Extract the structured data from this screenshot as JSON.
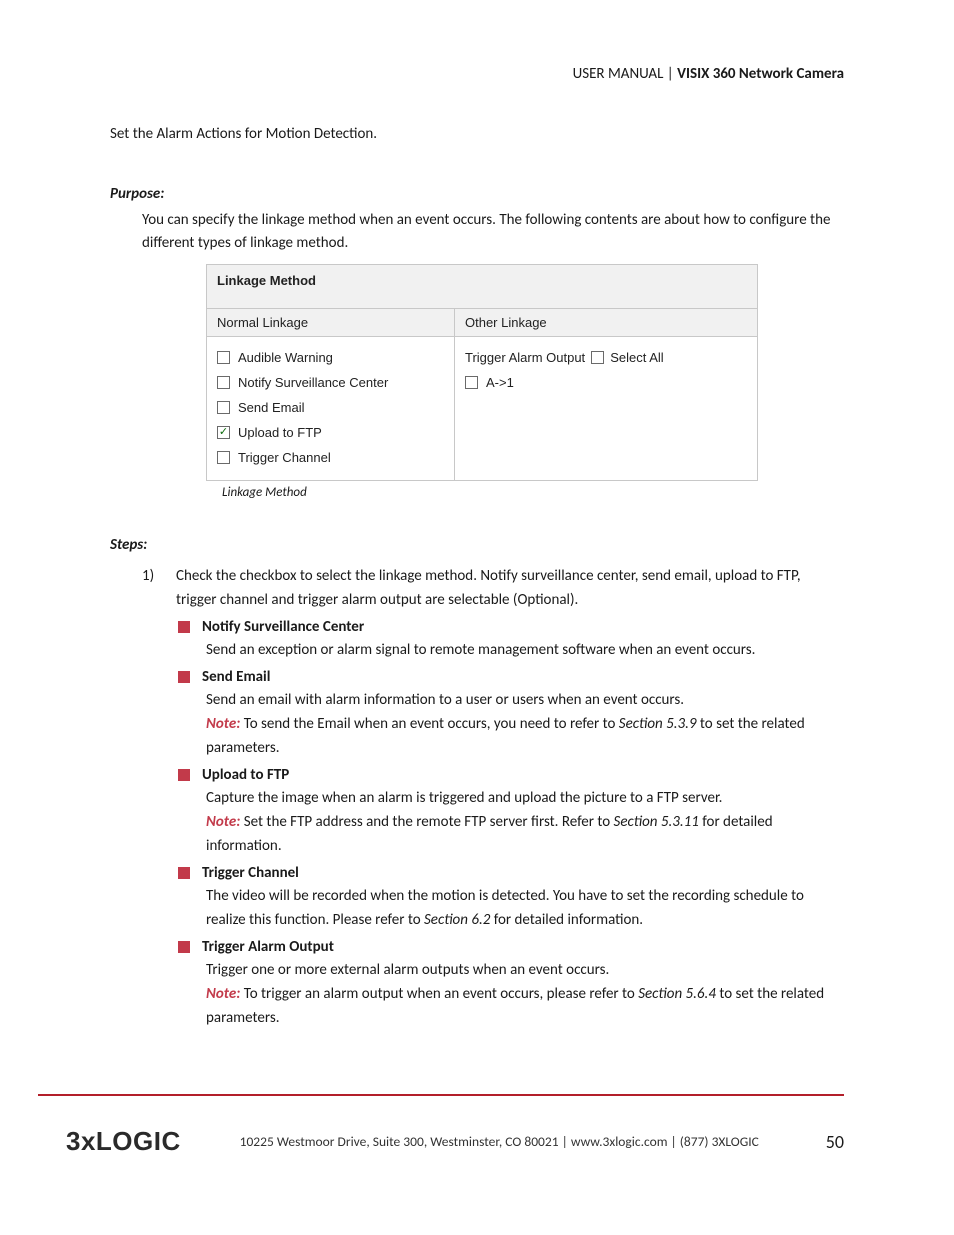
{
  "header": {
    "prefix": "USER MANUAL | ",
    "title": "VISIX 360 Network Camera"
  },
  "intro": "Set the Alarm Actions for Motion Detection.",
  "purpose": {
    "label": "Purpose:",
    "body": "You can specify the linkage method when an event occurs. The following contents are about how to configure the different types of linkage method."
  },
  "figure": {
    "title": "Linkage Method",
    "col_left_head": "Normal Linkage",
    "col_right_head": "Other Linkage",
    "normal": [
      {
        "label": "Audible Warning",
        "checked": false
      },
      {
        "label": "Notify Surveillance Center",
        "checked": false
      },
      {
        "label": "Send Email",
        "checked": false
      },
      {
        "label": "Upload to FTP",
        "checked": true
      },
      {
        "label": "Trigger Channel",
        "checked": false
      }
    ],
    "other": {
      "trigger_label": "Trigger Alarm Output",
      "select_all": {
        "label": "Select All",
        "checked": false
      },
      "items": [
        {
          "label": "A->1",
          "checked": false
        }
      ]
    },
    "caption": "Linkage Method"
  },
  "steps": {
    "label": "Steps:",
    "num": "1)",
    "body": "Check the checkbox to select the linkage method. Notify surveillance center, send email, upload to FTP, trigger channel and trigger alarm output are selectable (Optional).",
    "items": [
      {
        "title": "Notify Surveillance Center",
        "lines": [
          {
            "t": "Send an exception or alarm signal to remote management software when an event occurs."
          }
        ]
      },
      {
        "title": "Send Email",
        "lines": [
          {
            "t": "Send an email with alarm information to a user or users when an event occurs."
          },
          {
            "note": true,
            "pre": " To send the Email when an event occurs, you need to refer to ",
            "ref": "Section 5.3.9",
            "post": " to set the related parameters."
          }
        ]
      },
      {
        "title": "Upload to FTP",
        "lines": [
          {
            "t": "Capture the image when an alarm is triggered and upload the picture to a FTP server."
          },
          {
            "note": true,
            "pre": " Set the FTP address and the remote FTP server first. Refer to ",
            "ref": "Section 5.3.11",
            "post": " for detailed information."
          }
        ]
      },
      {
        "title": "Trigger Channel",
        "lines": [
          {
            "pre": "The video will be recorded when the motion is detected. You have to set the recording schedule to realize this function. Please refer to ",
            "ref": "Section 6.2",
            "post": " for detailed information."
          }
        ]
      },
      {
        "title": "Trigger Alarm Output",
        "lines": [
          {
            "t": "Trigger one or more external alarm outputs when an event occurs."
          },
          {
            "note": true,
            "pre": " To trigger an alarm output when an event occurs, please refer to ",
            "ref": "Section 5.6.4",
            "post": " to set the related parameters."
          }
        ]
      }
    ]
  },
  "footer": {
    "brand": "3xLOGIC",
    "text": "10225 Westmoor Drive, Suite 300, Westminster, CO 80021 | www.3xlogic.com | (877) 3XLOGIC",
    "page": "50"
  },
  "labels": {
    "note": "Note:"
  }
}
